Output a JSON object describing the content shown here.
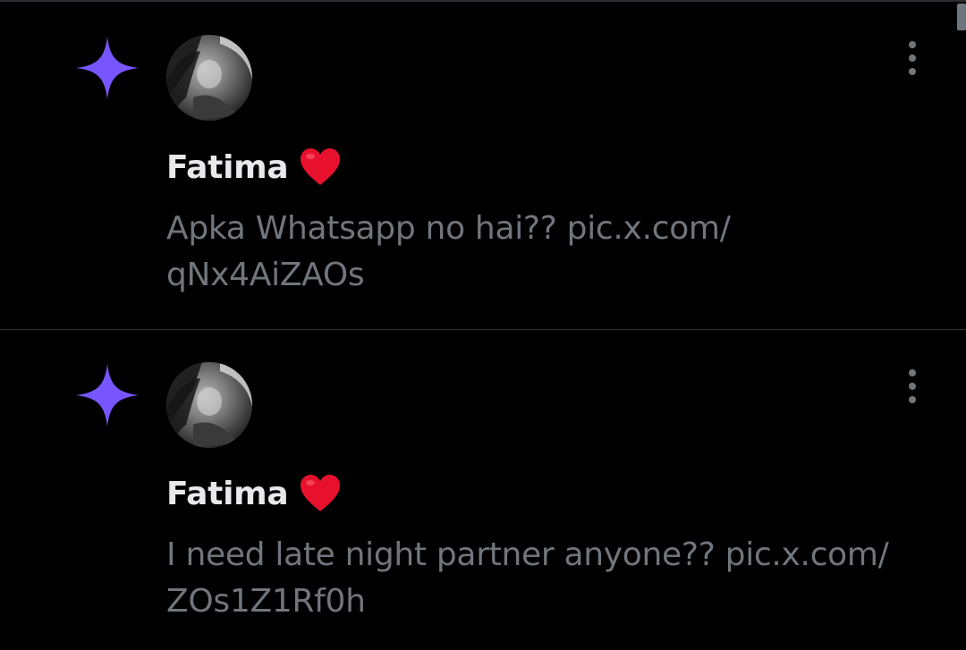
{
  "notifications": [
    {
      "name": "Fatima",
      "text_line1": "Apka Whatsapp no hai?? pic.x.com/",
      "text_line2": "qNx4AiZAOs"
    },
    {
      "name": "Fatima",
      "text_line1": "I need late night partner anyone?? pic.x.com/",
      "text_line2": "ZOs1Z1Rf0h"
    }
  ],
  "icons": {
    "sparkle": "sparkle-icon",
    "heart": "red-heart-emoji",
    "more": "more-vertical-icon"
  },
  "colors": {
    "background": "#000000",
    "accent_purple": "#7856ff",
    "name_text": "#e7e9ea",
    "body_text": "#71767b",
    "divider": "#2f3336",
    "heart_red": "#e8112d"
  }
}
